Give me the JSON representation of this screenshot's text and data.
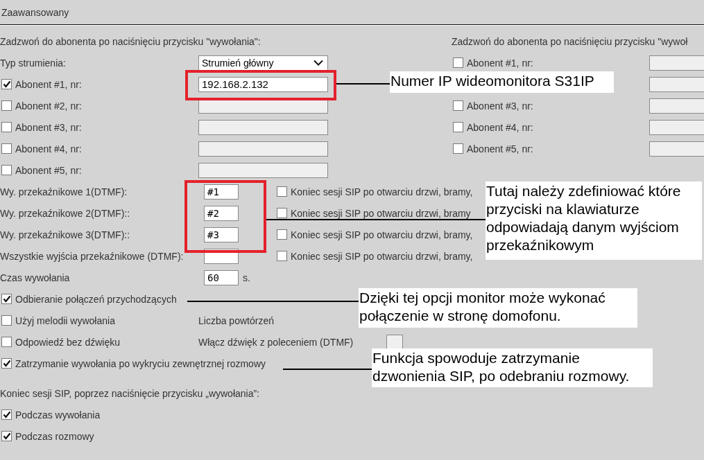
{
  "section_title": "Zaawansowany",
  "call_left": {
    "heading": "Zadzwoń do abonenta po naciśnięciu przycisku \"wywołania\":",
    "stream_type": {
      "label": "Typ strumienia:",
      "value": "Strumień główny"
    },
    "subscribers": [
      {
        "kind": "checkbox",
        "label": "Abonent #1, nr:",
        "checked": true,
        "value": "192.168.2.132"
      },
      {
        "kind": "checkbox",
        "label": "Abonent #2, nr:",
        "checked": false
      },
      {
        "kind": "checkbox",
        "label": "Abonent #3, nr:",
        "checked": false
      },
      {
        "kind": "checkbox",
        "label": "Abonent #4, nr:",
        "checked": false
      },
      {
        "kind": "checkbox",
        "label": "Abonent #5, nr:",
        "checked": false
      }
    ]
  },
  "call_right": {
    "heading": "Zadzwoń do abonenta po naciśnięciu przycisku \"wywoł",
    "subscribers": [
      {
        "kind": "checkbox",
        "label": "Abonent #1, nr:",
        "checked": false
      },
      {
        "kind": "field_only"
      },
      {
        "kind": "checkbox",
        "label": "Abonent #3, nr:",
        "checked": false
      },
      {
        "kind": "checkbox",
        "label": "Abonent #4, nr:",
        "checked": false
      },
      {
        "kind": "checkbox",
        "label": "Abonent #5, nr:",
        "checked": false
      }
    ]
  },
  "relays": [
    {
      "label": "Wy. przekaźnikowe 1(DTMF):",
      "value": "#1",
      "end_session": {
        "label": "Koniec sesji SIP po otwarciu drzwi, bramy,",
        "checked": false
      }
    },
    {
      "label": "Wy. przekaźnikowe 2(DTMF)::",
      "value": "#2",
      "end_session": {
        "label": "Koniec sesji SIP po otwarciu drzwi, bramy",
        "checked": false
      }
    },
    {
      "label": "Wy. przekaźnikowe 3(DTMF)::",
      "value": "#3",
      "end_session": {
        "label": "Koniec sesji SIP po otwarciu drzwi, bramy,",
        "checked": false
      }
    },
    {
      "label": "Wszystkie wyjścia przekaźnikowe (DTMF):",
      "end_session": {
        "label": "Koniec sesji SIP po otwarciu drzwi, bramy,",
        "checked": false
      }
    }
  ],
  "call_time": {
    "label": "Czas wywołania",
    "value": "60",
    "unit": "s."
  },
  "options": [
    {
      "kind": "checkbox",
      "label": "Odbieranie połączeń przychodzących",
      "checked": true
    },
    {
      "kind": "with_extra",
      "label": "Użyj melodii wywołania",
      "checked": false,
      "extra_label": "Liczba powtórzeń"
    },
    {
      "kind": "with_extra_field",
      "label": "Odpowiedź bez dźwięku",
      "checked": false,
      "extra_label": "Włącz dźwięk z poleceniem (DTMF)"
    },
    {
      "kind": "checkbox",
      "label": "Zatrzymanie wywołania po wykryciu zewnętrznej rozmowy",
      "checked": true
    }
  ],
  "end_session": {
    "heading": "Koniec sesji SIP, poprzez naciśnięcie przycisku „wywołania”:",
    "options": [
      {
        "label": "Podczas wywołania",
        "checked": true
      },
      {
        "label": "Podczas rozmowy",
        "checked": true
      }
    ]
  },
  "annotations": [
    {
      "text": "Numer IP wideomonitora S31IP"
    },
    {
      "text": "Tutaj należy zdefiniować które\nprzyciski na klawiaturze\nodpowiadają danym wyjściom\nprzekaźnikowym"
    },
    {
      "text": "Dzięki tej opcji monitor może wykonać\npołączenie w stronę domofonu."
    },
    {
      "text": "Funkcja spowoduje zatrzymanie\ndzwonienia SIP, po odebraniu rozmowy."
    }
  ]
}
